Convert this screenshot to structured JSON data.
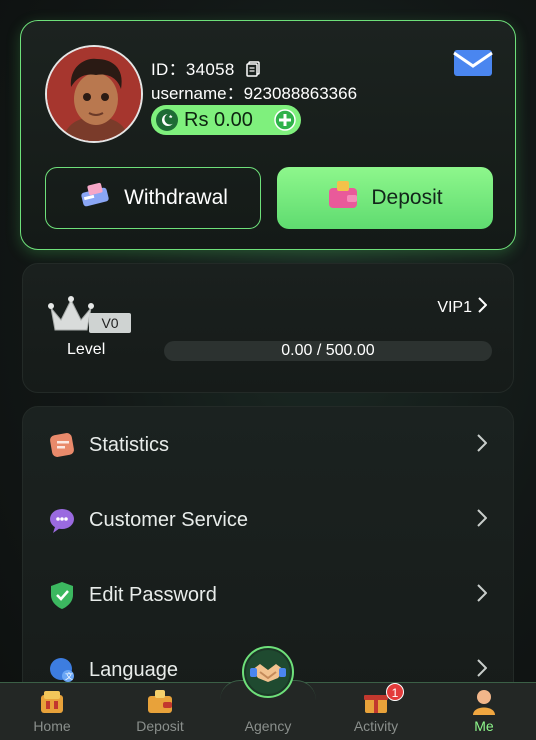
{
  "profile": {
    "id_label": "ID：34058",
    "username_label": "username：923088863366",
    "balance": "Rs 0.00"
  },
  "actions": {
    "withdrawal": "Withdrawal",
    "deposit": "Deposit"
  },
  "vip": {
    "badge": "V0",
    "level_label": "Level",
    "next": "VIP1",
    "progress_text": "0.00 / 500.00",
    "progress_fraction": 0
  },
  "menu": {
    "items": [
      {
        "label": "Statistics",
        "icon": "statistics-icon"
      },
      {
        "label": "Customer Service",
        "icon": "customer-service-icon"
      },
      {
        "label": "Edit Password",
        "icon": "shield-icon"
      },
      {
        "label": "Language",
        "icon": "language-icon"
      }
    ]
  },
  "nav": {
    "home": "Home",
    "deposit": "Deposit",
    "agency": "Agency",
    "activity": "Activity",
    "activity_badge": "1",
    "me": "Me"
  },
  "colors": {
    "accent": "#6ee07a",
    "button_green": "#7ff07d",
    "badge_red": "#e33b3b"
  }
}
